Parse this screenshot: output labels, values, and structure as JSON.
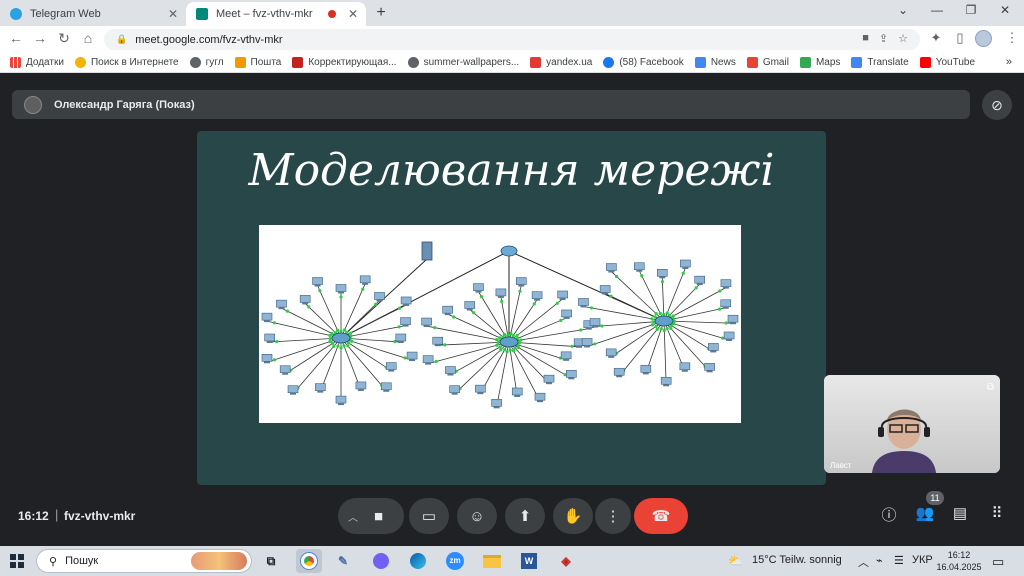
{
  "browser": {
    "tabs": [
      {
        "title": "Telegram Web",
        "favicon_color": "#2aa3e0"
      },
      {
        "title": "Meet – fvz-vthv-mkr",
        "favicon_color": "#00897b"
      }
    ],
    "new_tab_symbol": "+",
    "url": "meet.google.com/fvz-vthv-mkr",
    "bookmarks": [
      {
        "label": "Додатки",
        "icon_color": "#e8453c"
      },
      {
        "label": "Поиск в Интернете",
        "icon_color": "#f4b400"
      },
      {
        "label": "гугл",
        "icon_color": "#5f6368"
      },
      {
        "label": "Пошта",
        "icon_color": "#f29900"
      },
      {
        "label": "Корректирующая...",
        "icon_color": "#c5221f"
      },
      {
        "label": "summer-wallpapers...",
        "icon_color": "#5f6368"
      },
      {
        "label": "yandex.ua",
        "icon_color": "#e53935"
      },
      {
        "label": "(58) Facebook",
        "icon_color": "#1877f2"
      },
      {
        "label": "News",
        "icon_color": "#4285f4"
      },
      {
        "label": "Gmail",
        "icon_color": "#ea4335"
      },
      {
        "label": "Maps",
        "icon_color": "#34a853"
      },
      {
        "label": "Translate",
        "icon_color": "#4285f4"
      },
      {
        "label": "YouTube",
        "icon_color": "#ff0000"
      }
    ],
    "bookmarks_more": "»"
  },
  "meet": {
    "presenter": "Олександр Гаряга (Показ)",
    "slide_title": "Моделювання мережі",
    "self_name": "Лавст",
    "time": "16:12",
    "separator": "|",
    "meeting_code": "fvz-vthv-mkr",
    "participants_count": "11",
    "colors": {
      "hangup": "#ea4335",
      "slide_bg": "#274749",
      "control_bg": "#3c4043"
    }
  },
  "taskbar": {
    "search_placeholder": "Пошук",
    "weather": "15°C  Teilw. sonnig",
    "lang": "УКР",
    "time": "16:12",
    "date": "16.04.2025"
  }
}
